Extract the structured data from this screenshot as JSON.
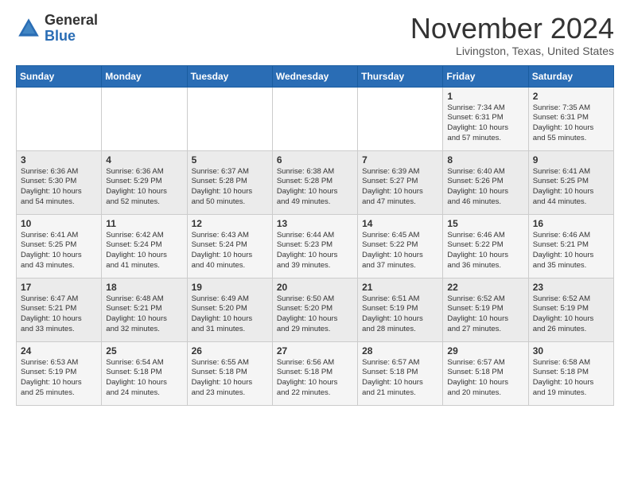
{
  "header": {
    "logo_general": "General",
    "logo_blue": "Blue",
    "month_title": "November 2024",
    "location": "Livingston, Texas, United States"
  },
  "days_of_week": [
    "Sunday",
    "Monday",
    "Tuesday",
    "Wednesday",
    "Thursday",
    "Friday",
    "Saturday"
  ],
  "weeks": [
    [
      {
        "day": "",
        "info": ""
      },
      {
        "day": "",
        "info": ""
      },
      {
        "day": "",
        "info": ""
      },
      {
        "day": "",
        "info": ""
      },
      {
        "day": "",
        "info": ""
      },
      {
        "day": "1",
        "info": "Sunrise: 7:34 AM\nSunset: 6:31 PM\nDaylight: 10 hours\nand 57 minutes."
      },
      {
        "day": "2",
        "info": "Sunrise: 7:35 AM\nSunset: 6:31 PM\nDaylight: 10 hours\nand 55 minutes."
      }
    ],
    [
      {
        "day": "3",
        "info": "Sunrise: 6:36 AM\nSunset: 5:30 PM\nDaylight: 10 hours\nand 54 minutes."
      },
      {
        "day": "4",
        "info": "Sunrise: 6:36 AM\nSunset: 5:29 PM\nDaylight: 10 hours\nand 52 minutes."
      },
      {
        "day": "5",
        "info": "Sunrise: 6:37 AM\nSunset: 5:28 PM\nDaylight: 10 hours\nand 50 minutes."
      },
      {
        "day": "6",
        "info": "Sunrise: 6:38 AM\nSunset: 5:28 PM\nDaylight: 10 hours\nand 49 minutes."
      },
      {
        "day": "7",
        "info": "Sunrise: 6:39 AM\nSunset: 5:27 PM\nDaylight: 10 hours\nand 47 minutes."
      },
      {
        "day": "8",
        "info": "Sunrise: 6:40 AM\nSunset: 5:26 PM\nDaylight: 10 hours\nand 46 minutes."
      },
      {
        "day": "9",
        "info": "Sunrise: 6:41 AM\nSunset: 5:25 PM\nDaylight: 10 hours\nand 44 minutes."
      }
    ],
    [
      {
        "day": "10",
        "info": "Sunrise: 6:41 AM\nSunset: 5:25 PM\nDaylight: 10 hours\nand 43 minutes."
      },
      {
        "day": "11",
        "info": "Sunrise: 6:42 AM\nSunset: 5:24 PM\nDaylight: 10 hours\nand 41 minutes."
      },
      {
        "day": "12",
        "info": "Sunrise: 6:43 AM\nSunset: 5:24 PM\nDaylight: 10 hours\nand 40 minutes."
      },
      {
        "day": "13",
        "info": "Sunrise: 6:44 AM\nSunset: 5:23 PM\nDaylight: 10 hours\nand 39 minutes."
      },
      {
        "day": "14",
        "info": "Sunrise: 6:45 AM\nSunset: 5:22 PM\nDaylight: 10 hours\nand 37 minutes."
      },
      {
        "day": "15",
        "info": "Sunrise: 6:46 AM\nSunset: 5:22 PM\nDaylight: 10 hours\nand 36 minutes."
      },
      {
        "day": "16",
        "info": "Sunrise: 6:46 AM\nSunset: 5:21 PM\nDaylight: 10 hours\nand 35 minutes."
      }
    ],
    [
      {
        "day": "17",
        "info": "Sunrise: 6:47 AM\nSunset: 5:21 PM\nDaylight: 10 hours\nand 33 minutes."
      },
      {
        "day": "18",
        "info": "Sunrise: 6:48 AM\nSunset: 5:21 PM\nDaylight: 10 hours\nand 32 minutes."
      },
      {
        "day": "19",
        "info": "Sunrise: 6:49 AM\nSunset: 5:20 PM\nDaylight: 10 hours\nand 31 minutes."
      },
      {
        "day": "20",
        "info": "Sunrise: 6:50 AM\nSunset: 5:20 PM\nDaylight: 10 hours\nand 29 minutes."
      },
      {
        "day": "21",
        "info": "Sunrise: 6:51 AM\nSunset: 5:19 PM\nDaylight: 10 hours\nand 28 minutes."
      },
      {
        "day": "22",
        "info": "Sunrise: 6:52 AM\nSunset: 5:19 PM\nDaylight: 10 hours\nand 27 minutes."
      },
      {
        "day": "23",
        "info": "Sunrise: 6:52 AM\nSunset: 5:19 PM\nDaylight: 10 hours\nand 26 minutes."
      }
    ],
    [
      {
        "day": "24",
        "info": "Sunrise: 6:53 AM\nSunset: 5:19 PM\nDaylight: 10 hours\nand 25 minutes."
      },
      {
        "day": "25",
        "info": "Sunrise: 6:54 AM\nSunset: 5:18 PM\nDaylight: 10 hours\nand 24 minutes."
      },
      {
        "day": "26",
        "info": "Sunrise: 6:55 AM\nSunset: 5:18 PM\nDaylight: 10 hours\nand 23 minutes."
      },
      {
        "day": "27",
        "info": "Sunrise: 6:56 AM\nSunset: 5:18 PM\nDaylight: 10 hours\nand 22 minutes."
      },
      {
        "day": "28",
        "info": "Sunrise: 6:57 AM\nSunset: 5:18 PM\nDaylight: 10 hours\nand 21 minutes."
      },
      {
        "day": "29",
        "info": "Sunrise: 6:57 AM\nSunset: 5:18 PM\nDaylight: 10 hours\nand 20 minutes."
      },
      {
        "day": "30",
        "info": "Sunrise: 6:58 AM\nSunset: 5:18 PM\nDaylight: 10 hours\nand 19 minutes."
      }
    ]
  ]
}
